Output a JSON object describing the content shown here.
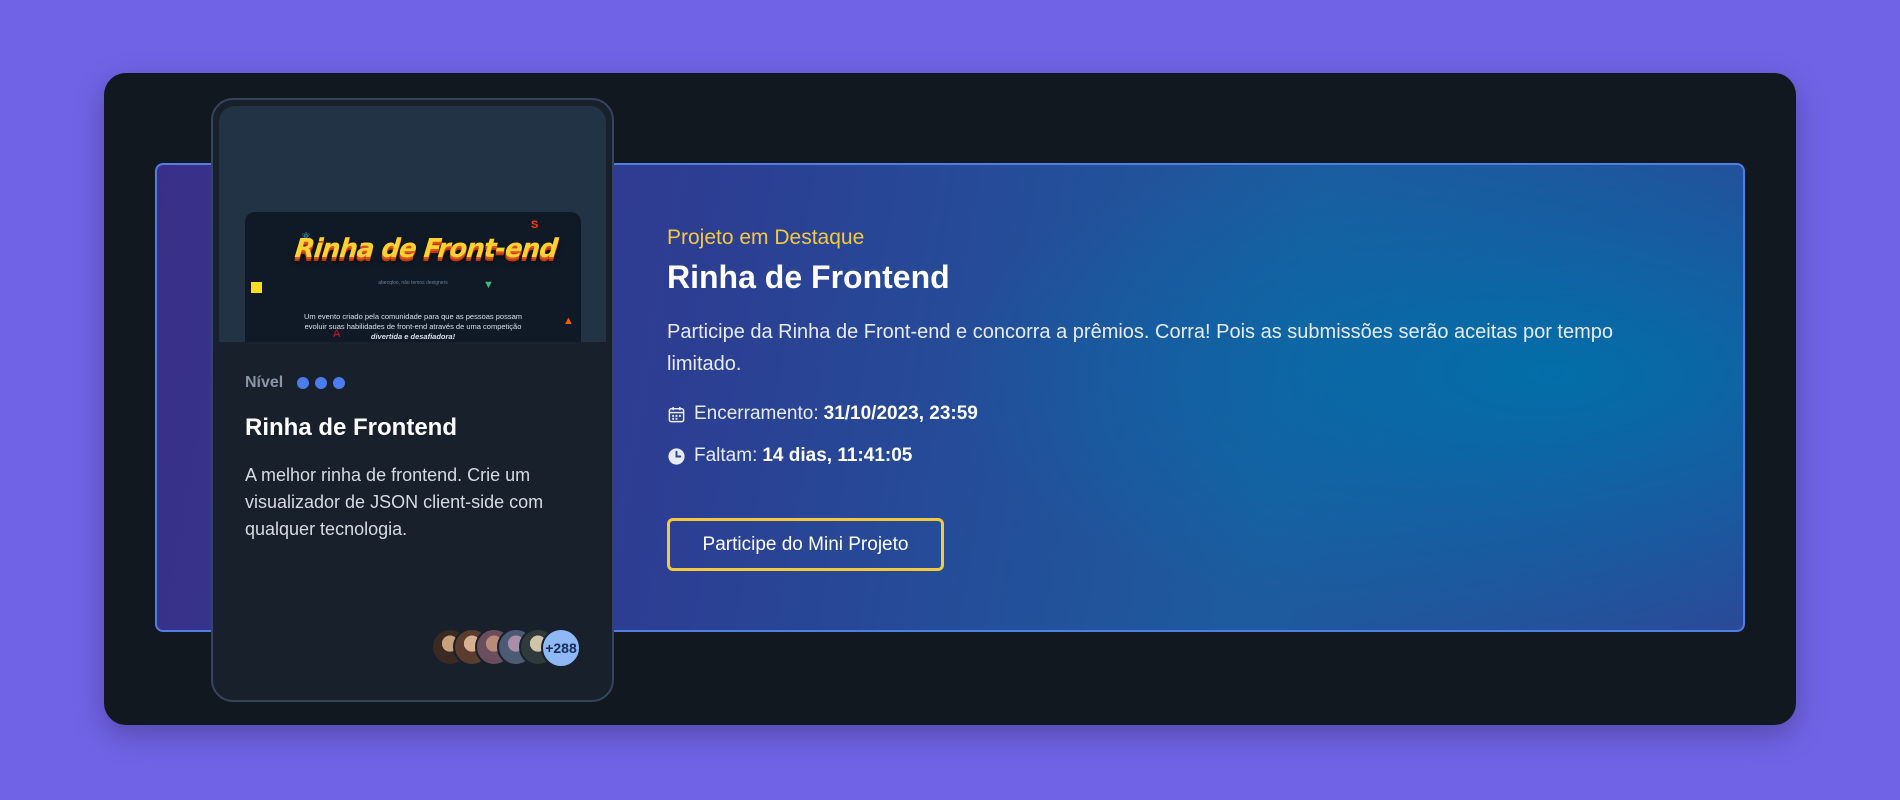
{
  "featured": {
    "eyebrow": "Projeto em Destaque",
    "title": "Rinha de Frontend",
    "description": "Participe da Rinha de Front-end e concorra a prêmios. Corra! Pois as submissões serão aceitas por tempo limitado.",
    "deadline_label": "Encerramento:",
    "deadline_value": "31/10/2023, 23:59",
    "remaining_label": "Faltam:",
    "remaining_value": "14 dias, 11:41:05",
    "cta_label": "Participe do Mini Projeto",
    "icons": {
      "deadline": "calendar-icon",
      "remaining": "clock-icon"
    }
  },
  "card": {
    "thumbnail": {
      "title": "Rinha de Front-end",
      "subtitle": "abecqloo, não temos designers",
      "desc_line1": "Um evento criado pela comunidade para que as pessoas possam",
      "desc_line2": "evoluir suas habilidades de front-end através de uma competição",
      "desc_line3": "divertida e desafiadora!"
    },
    "level_label": "Nível",
    "level_value": 3,
    "level_max": 3,
    "title": "Rinha de Frontend",
    "description": "A melhor rinha de frontend. Crie um visualizador de JSON client-side com qualquer tecnologia.",
    "participants_more": "+288"
  },
  "colors": {
    "page_bg": "#7163e6",
    "panel_bg": "#121820",
    "accent_yellow": "#f5c842",
    "level_dot": "#4c7cf0",
    "banner_border": "#4f7fe6"
  }
}
